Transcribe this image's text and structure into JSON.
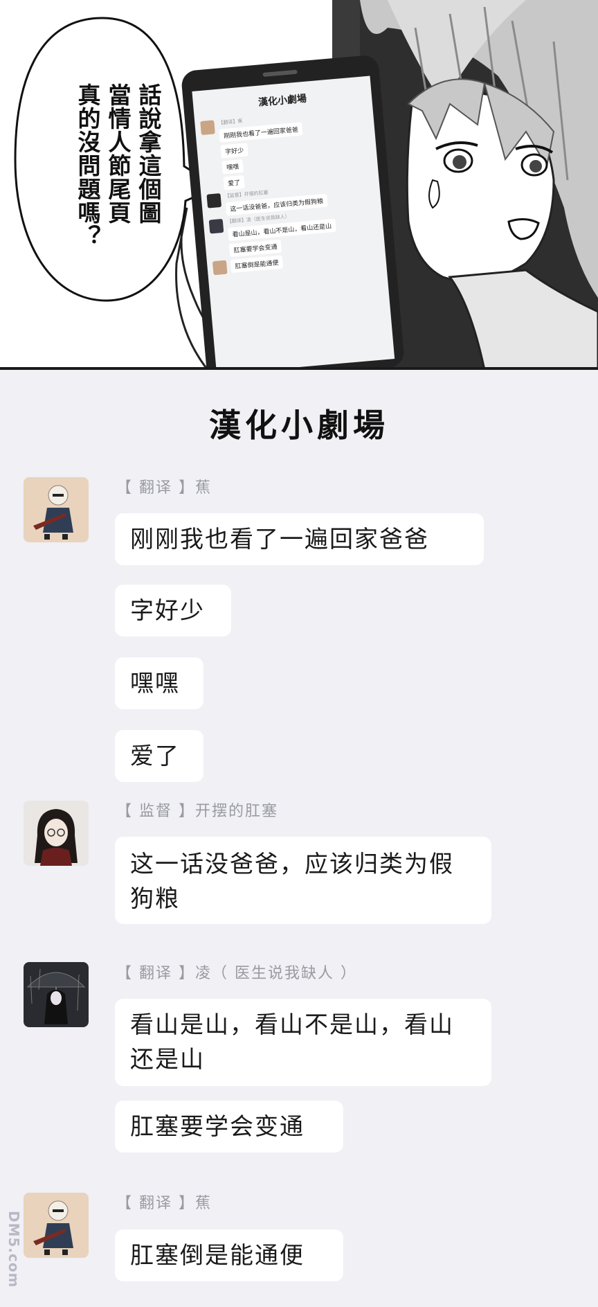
{
  "panel": {
    "bubble_lines": [
      "話說拿這個圖",
      "當情人節尾頁",
      "真的沒問題嗎？"
    ],
    "phone": {
      "title": "漢化小劇場",
      "messages": [
        {
          "sender": "【翻译】蕉",
          "texts": [
            "刚刚我也看了一遍回家爸爸",
            "字好少",
            "嘿嘿",
            "爱了"
          ]
        },
        {
          "sender": "【监督】开摆的肛塞",
          "texts": [
            "这一话没爸爸，应该归类为假狗粮"
          ]
        },
        {
          "sender": "【翻译】凌（医生说我缺人）",
          "texts": [
            "看山是山，看山不是山，看山还是山",
            "肛塞要学会变通"
          ]
        },
        {
          "sender": "",
          "texts": [
            "肛塞倒是能通便"
          ]
        }
      ]
    }
  },
  "chat": {
    "title": "漢化小劇場",
    "groups": [
      {
        "sender": "【 翻译 】蕉",
        "messages": [
          "刚刚我也看了一遍回家爸爸",
          "字好少",
          "嘿嘿",
          "爱了"
        ]
      },
      {
        "sender": "【 监督 】开摆的肛塞",
        "messages": [
          "这一话没爸爸，应该归类为假狗粮"
        ]
      },
      {
        "sender": "【 翻译 】凌（ 医生说我缺人 ）",
        "messages": [
          "看山是山，看山不是山，看山还是山",
          "肛塞要学会变通"
        ]
      },
      {
        "sender": "【 翻译 】蕉",
        "messages": [
          "肛塞倒是能通便"
        ]
      }
    ]
  },
  "watermark": "DM5.com",
  "colors": {
    "chat_background": "#f0f0f5",
    "bubble": "#ffffff",
    "sender_text": "#9a9aa2",
    "message_text": "#1a1a1a"
  }
}
